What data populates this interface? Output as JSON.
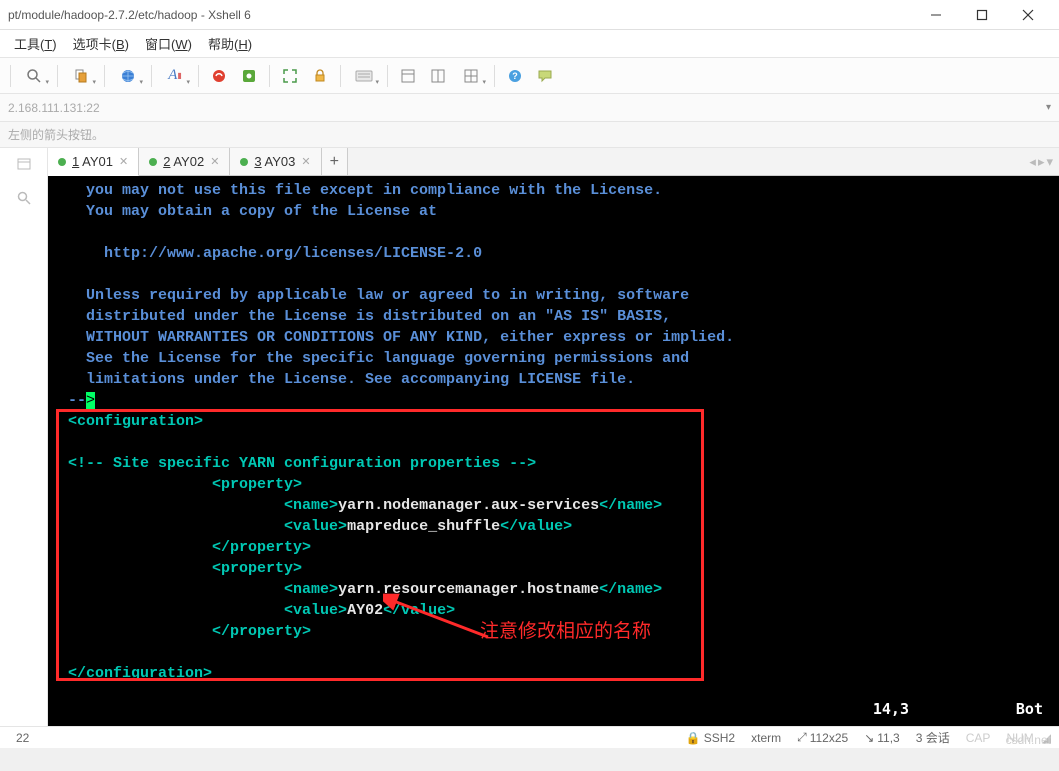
{
  "window": {
    "title": "pt/module/hadoop-2.7.2/etc/hadoop - Xshell 6"
  },
  "menu": {
    "tools": "工具(T)",
    "tabs": "选项卡(B)",
    "window": "窗口(W)",
    "help": "帮助(H)"
  },
  "address": "2.168.111.131:22",
  "hint": "左侧的箭头按钮。",
  "tabs": [
    {
      "num": "1",
      "label": "AY01",
      "active": true
    },
    {
      "num": "2",
      "label": "AY02",
      "active": false
    },
    {
      "num": "3",
      "label": "AY03",
      "active": false
    }
  ],
  "terminal": {
    "comment_lines": [
      "  you may not use this file except in compliance with the License.",
      "  You may obtain a copy of the License at",
      "",
      "    http://www.apache.org/licenses/LICENSE-2.0",
      "",
      "  Unless required by applicable law or agreed to in writing, software",
      "  distributed under the License is distributed on an \"AS IS\" BASIS,",
      "  WITHOUT WARRANTIES OR CONDITIONS OF ANY KIND, either express or implied.",
      "  See the License for the specific language governing permissions and",
      "  limitations under the License. See accompanying LICENSE file.",
      "--"
    ],
    "cursor_char": ">",
    "cfg_open": "<configuration>",
    "blank": "",
    "site_comment": "<!-- Site specific YARN configuration properties -->",
    "prop_open": "<property>",
    "name_open": "<name>",
    "name1_val": "yarn.nodemanager.aux-services",
    "name_close": "</name>",
    "value_open": "<value>",
    "value1_val": "mapreduce_shuffle",
    "value_close": "</value>",
    "prop_close": "</property>",
    "name2_val": "yarn.resourcemanager.hostname",
    "value2_val": "AY02",
    "cfg_close": "</configuration>",
    "indent1": "                ",
    "indent2": "                        ",
    "pos": "14,3",
    "bot": "Bot"
  },
  "annotation": "注意修改相应的名称",
  "status": {
    "left": "22",
    "ssh": "SSH2",
    "term": "xterm",
    "size": "112x25",
    "cursor": "11,3",
    "sessions": "3 会话",
    "caps": "CAP",
    "num": "NUM"
  },
  "watermark": "csdn.net"
}
